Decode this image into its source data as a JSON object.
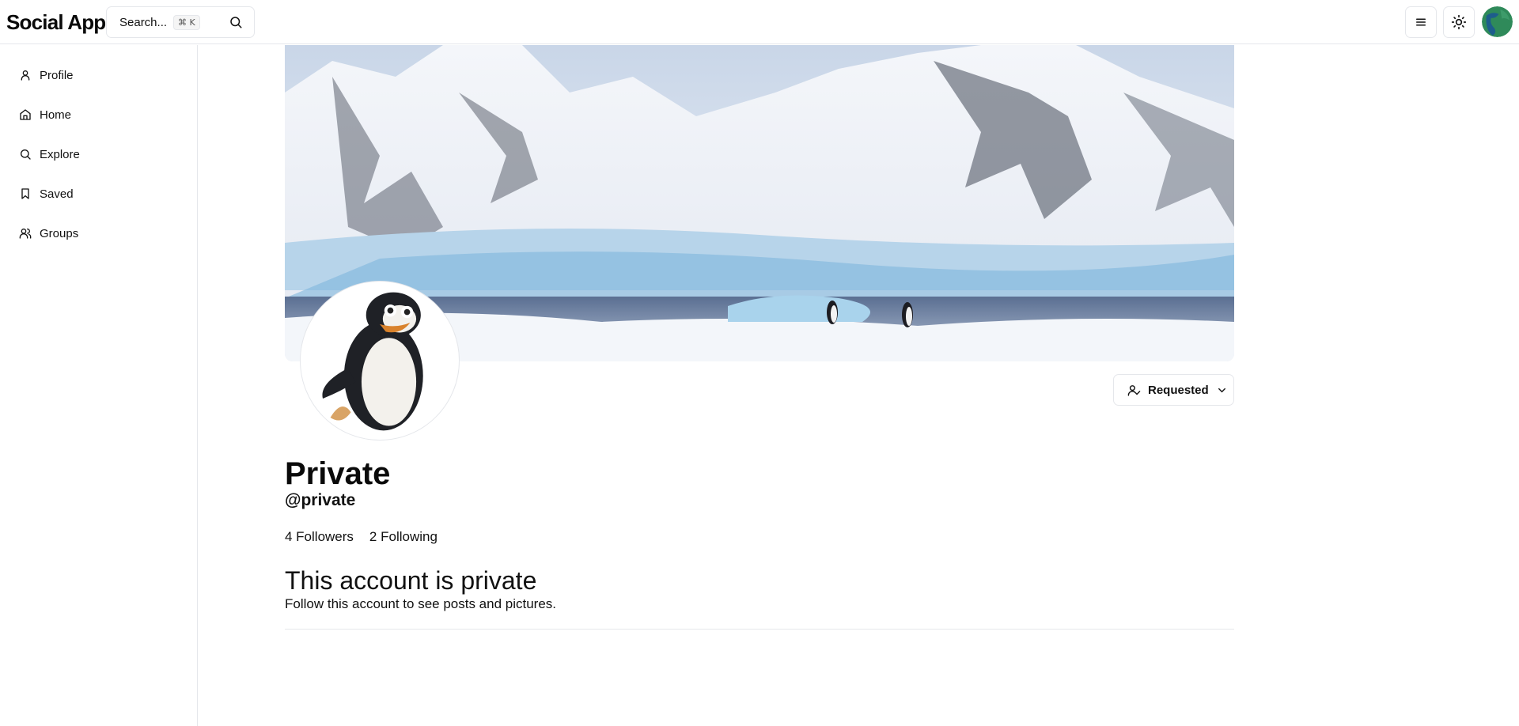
{
  "app": {
    "brand": "Social App"
  },
  "search": {
    "placeholder": "Search...",
    "shortcut": "⌘ K"
  },
  "sidebar": {
    "items": [
      {
        "label": "Profile",
        "icon": "user-icon"
      },
      {
        "label": "Home",
        "icon": "home-icon"
      },
      {
        "label": "Explore",
        "icon": "search-icon"
      },
      {
        "label": "Saved",
        "icon": "bookmark-icon"
      },
      {
        "label": "Groups",
        "icon": "users-icon"
      }
    ]
  },
  "profile": {
    "display_name": "Private",
    "handle": "@private",
    "followers": "4 Followers",
    "following": "2 Following",
    "follow_button": "Requested"
  },
  "private_notice": {
    "title": "This account is private",
    "subtitle": "Follow this account to see posts and pictures."
  },
  "colors": {
    "border": "#e5e7eb",
    "text": "#0a0a0a",
    "avatar": "#2f8a5a"
  }
}
